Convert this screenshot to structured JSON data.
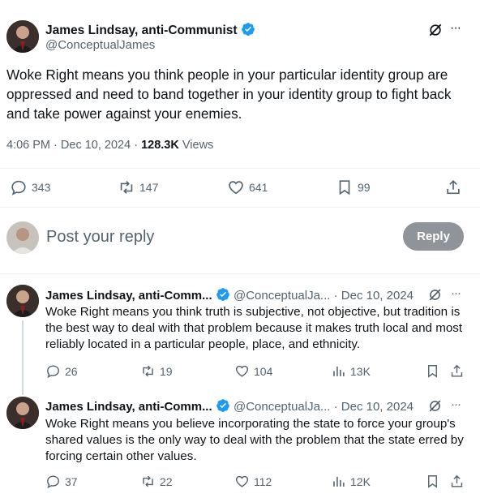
{
  "main_post": {
    "author_name": "James Lindsay, anti-Communist",
    "handle": "@ConceptualJames",
    "text": "Woke Right means you think people in your particular identity group are oppressed and need to band together in your identity group to fight back and take power against your enemies.",
    "time": "4:06 PM",
    "date": "Dec 10, 2024",
    "separator": "·",
    "views_count": "128.3K",
    "views_label": "Views",
    "replies": "343",
    "reposts": "147",
    "likes": "641",
    "bookmarks": "99",
    "more": "···"
  },
  "compose": {
    "placeholder": "Post your reply",
    "button": "Reply"
  },
  "replies": [
    {
      "author_name": "James Lindsay, anti-Comm...",
      "handle": "@ConceptualJa...",
      "date": "· Dec 10, 2024",
      "text": "Woke Right means you think truth is subjective, not objective, but tradition is the best way to deal with that problem because it makes truth local and most reliably located in a particular people, place, and ethnicity.",
      "replies": "26",
      "reposts": "19",
      "likes": "104",
      "views": "13K",
      "more": "···"
    },
    {
      "author_name": "James Lindsay, anti-Comm...",
      "handle": "@ConceptualJa...",
      "date": "· Dec 10, 2024",
      "text": "Woke Right means you believe incorporating the state to force your group's shared values is the only way to deal with the problem that the state erred by forcing certain other values.",
      "replies": "37",
      "reposts": "22",
      "likes": "112",
      "views": "12K",
      "more": "···"
    }
  ],
  "colors": {
    "verified": "#1d9bf0",
    "text": "#0f1419",
    "secondary": "#536471",
    "reply_button": "#8e9499"
  }
}
